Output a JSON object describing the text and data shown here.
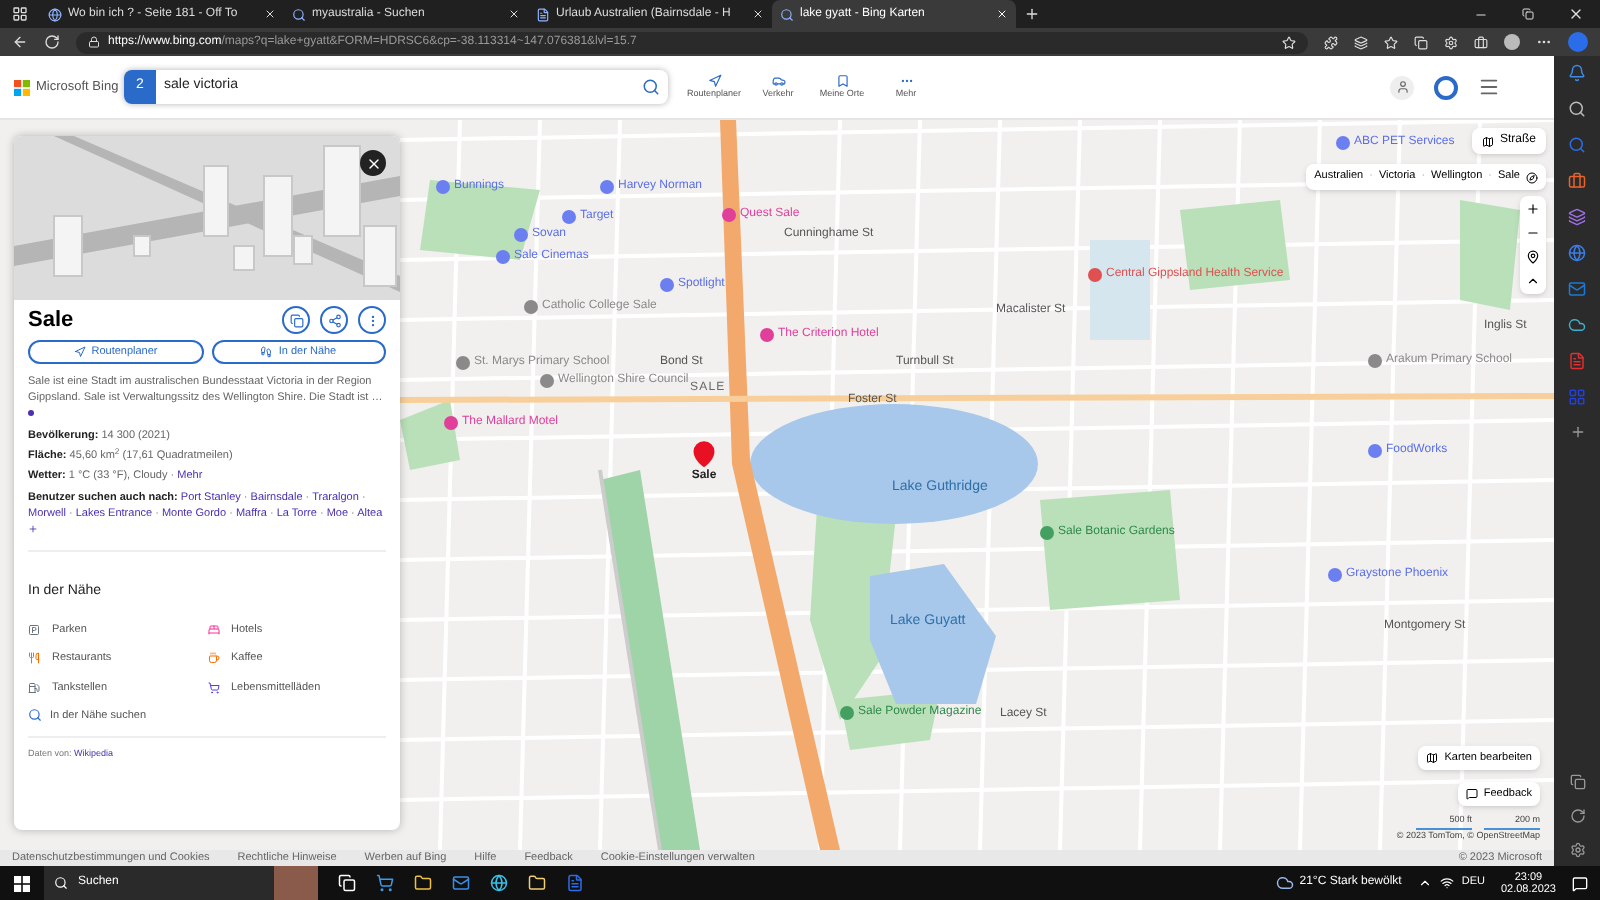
{
  "browser": {
    "tabs": [
      {
        "title": "Wo bin ich ? - Seite 181 - Off To",
        "kind": "forum",
        "selected": false
      },
      {
        "title": "myaustralia - Suchen",
        "kind": "search",
        "selected": false
      },
      {
        "title": "Urlaub Australien (Bairnsdale - H",
        "kind": "page",
        "selected": false
      },
      {
        "title": "lake gyatt - Bing Karten",
        "kind": "search",
        "selected": true
      }
    ],
    "url_host": "https://www.bing.com",
    "url_path": "/maps?q=lake+gyatt&FORM=HDRSC6&cp=-38.113314~147.076381&lvl=15.7"
  },
  "header": {
    "logo": "Microsoft Bing",
    "badge": "2",
    "query": "sale victoria",
    "nav": [
      {
        "label": "Routenplaner",
        "kind": "route"
      },
      {
        "label": "Verkehr",
        "kind": "traffic"
      },
      {
        "label": "Meine Orte",
        "kind": "places"
      },
      {
        "label": "Mehr",
        "kind": "more"
      }
    ]
  },
  "panel": {
    "title": "Sale",
    "actions": [
      {
        "label": "Routenplaner",
        "kind": "route"
      },
      {
        "label": "In der Nähe",
        "kind": "nearby"
      }
    ],
    "description": "Sale ist eine Stadt im australischen Bundesstaat Victoria in der Region Gippsland. Sale ist Verwaltungssitz des Wellington Shire. Die Stadt ist …",
    "facts": [
      {
        "label": "Bevölkerung:",
        "value": "14 300 (2021)"
      },
      {
        "label": "Fläche:",
        "value": "45,60 km$^{2}$ (17,61 Quadratmeilen)"
      },
      {
        "label": "Wetter:",
        "value": "1 °C (33 °F), Cloudy ·",
        "link": "Mehr"
      }
    ],
    "also_label": "Benutzer suchen auch nach:",
    "also_separator": "·",
    "also": [
      "Port Stanley",
      "Bairnsdale",
      "Traralgon",
      "Morwell",
      "Lakes Entrance",
      "Monte Gordo",
      "Maffra",
      "La Torre",
      "Moe",
      "Altea"
    ],
    "nearby": {
      "title": "In der Nähe",
      "items": [
        {
          "label": "Parken",
          "kind": "parking"
        },
        {
          "label": "Hotels",
          "kind": "hotel"
        },
        {
          "label": "Restaurants",
          "kind": "restaurant"
        },
        {
          "label": "Kaffee",
          "kind": "coffee"
        },
        {
          "label": "Tankstellen",
          "kind": "fuel"
        },
        {
          "label": "Lebensmittelläden",
          "kind": "grocery"
        }
      ],
      "search": "In der Nähe suchen"
    },
    "source_label": "Daten von:",
    "source_link": "Wikipedia"
  },
  "map": {
    "style_button": "Straße",
    "breadcrumb_separator": "·",
    "breadcrumb": [
      "Australien",
      "Victoria",
      "Wellington",
      "Sale"
    ],
    "labels": [
      {
        "text": "ABC PET Services",
        "kind": "poi"
      },
      {
        "text": "Bunnings",
        "kind": "poi"
      },
      {
        "text": "Harvey Norman",
        "kind": "poi"
      },
      {
        "text": "Target",
        "kind": "poi"
      },
      {
        "text": "Quest Sale",
        "kind": "hotel"
      },
      {
        "text": "Sovan",
        "kind": "poi"
      },
      {
        "text": "Sale Cinemas",
        "kind": "poi"
      },
      {
        "text": "Cunninghame St",
        "kind": "street"
      },
      {
        "text": "Spotlight",
        "kind": "poi"
      },
      {
        "text": "Central Gippsland Health Service",
        "kind": "health"
      },
      {
        "text": "Catholic College Sale",
        "kind": "school"
      },
      {
        "text": "Macalister St",
        "kind": "street"
      },
      {
        "text": "The Criterion Hotel",
        "kind": "hotel"
      },
      {
        "text": "St. Marys Primary School",
        "kind": "school"
      },
      {
        "text": "Bond St",
        "kind": "street"
      },
      {
        "text": "Turnbull St",
        "kind": "street"
      },
      {
        "text": "Wellington Shire Council",
        "kind": "school"
      },
      {
        "text": "SALE",
        "kind": "area"
      },
      {
        "text": "Foster St",
        "kind": "street"
      },
      {
        "text": "The Mallard Motel",
        "kind": "hotel"
      },
      {
        "text": "Lake Guthridge",
        "kind": "water"
      },
      {
        "text": "Sale Botanic Gardens",
        "kind": "park"
      },
      {
        "text": "Lake Guyatt",
        "kind": "water"
      },
      {
        "text": "Sale Powder Magazine",
        "kind": "park"
      },
      {
        "text": "Arakum Primary School",
        "kind": "school"
      },
      {
        "text": "FoodWorks",
        "kind": "poi"
      },
      {
        "text": "Graystone Phoenix",
        "kind": "poi"
      },
      {
        "text": "Inglis St",
        "kind": "street"
      },
      {
        "text": "Montgomery St",
        "kind": "street"
      },
      {
        "text": "Lacey St",
        "kind": "street"
      }
    ],
    "pin_label": "Sale",
    "edit_button": "Karten bearbeiten",
    "feedback_button": "Feedback",
    "scale": [
      "500 ft",
      "200 m"
    ],
    "attribution": "© 2023 TomTom, © OpenStreetMap"
  },
  "footer": {
    "links": [
      "Datenschutzbestimmungen und Cookies",
      "Rechtliche Hinweise",
      "Werben auf Bing",
      "Hilfe",
      "Feedback",
      "Cookie-Einstellungen verwalten"
    ],
    "copyright": "© 2023 Microsoft"
  },
  "taskbar": {
    "search": "Suchen",
    "temperature": "21°C",
    "weather": "Stark bewölkt",
    "language": "DEU",
    "time": "23:09",
    "date": "02.08.2023"
  }
}
